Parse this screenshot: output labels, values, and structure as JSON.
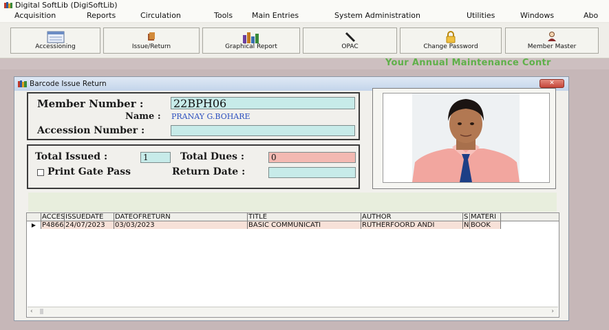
{
  "app": {
    "title": "Digital SoftLib (DigiSoftLib)"
  },
  "menu": [
    "Acquisition",
    "Reports",
    "Circulation",
    "Tools",
    "Main Entries",
    "System Administration",
    "Utilities",
    "Windows",
    "Abo"
  ],
  "toolbar": {
    "accessioning": "Accessioning",
    "issue_return": "Issue/Return",
    "graphical_report": "Graphical Report",
    "opac": "OPAC",
    "change_password": "Change Password",
    "member_master": "Member Master"
  },
  "marquee": "Your Annual Maintenance Contr",
  "dialog": {
    "title": "Barcode Issue Return",
    "close": "✕",
    "member_number_label": "Member Number :",
    "member_number": "22BPH06",
    "name_label": "Name :",
    "name": "PRANAY G.BOHARE",
    "accession_label": "Accession Number :",
    "accession": "",
    "total_issued_label": "Total Issued :",
    "total_issued": "1",
    "total_dues_label": "Total Dues :",
    "total_dues": "0",
    "print_gate_pass": "Print Gate Pass",
    "return_date_label": "Return Date :",
    "return_date": ""
  },
  "grid": {
    "headers": [
      "ACCES",
      "ISSUEDATE",
      "DATEOFRETURN",
      "TITLE",
      "AUTHOR",
      "S",
      "MATERI"
    ],
    "rows": [
      [
        "P4866",
        "24/07/2023",
        "03/03/2023",
        "BASIC COMMUNICATI",
        "RUTHERFOORD ANDI",
        "N",
        "BOOK"
      ]
    ]
  },
  "colors": {
    "field_cyan": "#c7ebe9",
    "field_pink": "#f3b9b2",
    "marquee_green": "#5fb04a",
    "name_blue": "#2b4fbf"
  }
}
